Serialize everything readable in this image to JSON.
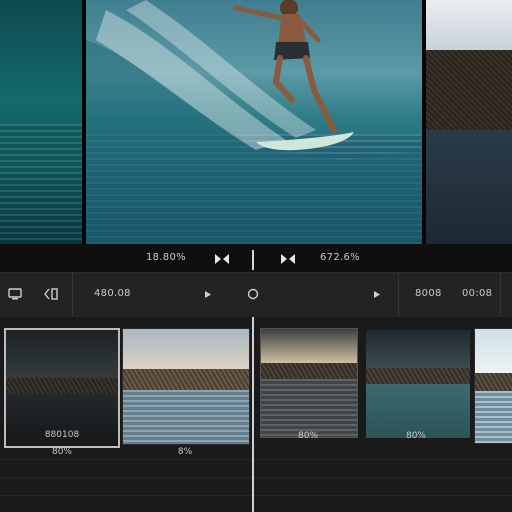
{
  "transport": {
    "left_value": "18.80%",
    "right_value": "672.6%",
    "mark_in_icon": "bowtie-icon",
    "mark_out_icon": "bowtie-icon"
  },
  "toolbar": {
    "left_icons": [
      "monitor-icon",
      "split-icon"
    ],
    "left_value": "480.08",
    "play_icon": "play-icon",
    "record_icon": "circle-icon",
    "next_icon": "play-icon",
    "right_value_1": "8008",
    "right_value_2": "00:08"
  },
  "clips": [
    {
      "label": "880108"
    },
    {
      "label": "8%"
    },
    {
      "label": "80%"
    },
    {
      "label": "80%"
    }
  ],
  "track_label": "80%",
  "colors": {
    "selected_clip_border": "#bdbdbd",
    "playhead": "#d8d8d8",
    "panel_bg": "#232323"
  }
}
